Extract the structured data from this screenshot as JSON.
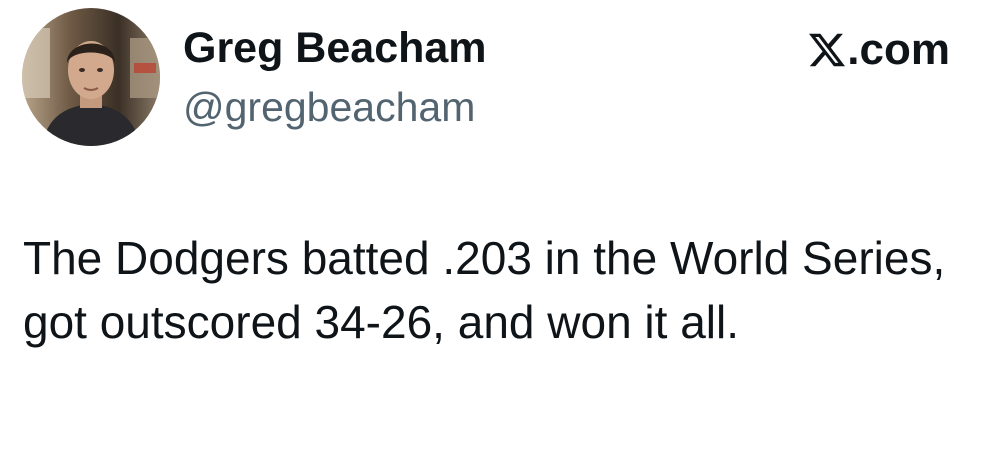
{
  "author": {
    "display_name": "Greg Beacham",
    "handle": "@gregbeacham",
    "avatar_icon": "profile-photo"
  },
  "source": {
    "logo_icon": "x-logo-icon",
    "label": ".com"
  },
  "tweet": {
    "text": "The Dodgers batted .203 in the World Series, got outscored 34-26, and won it all."
  },
  "colors": {
    "primary_text": "#0f1419",
    "secondary_text": "#536471",
    "background": "#ffffff"
  }
}
